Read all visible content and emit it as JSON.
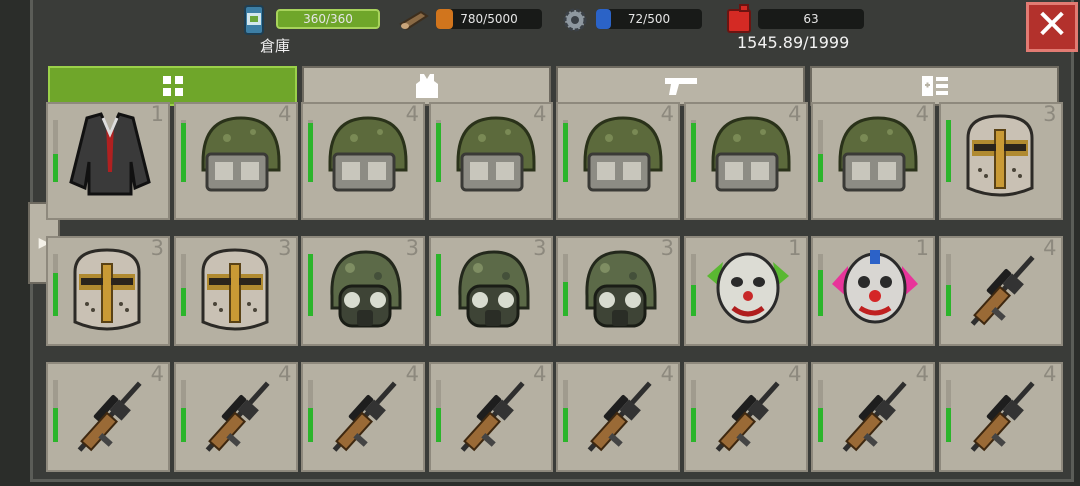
{
  "resources": {
    "food": {
      "icon": "food-can-icon",
      "value": "360/360",
      "fill": 1.0
    },
    "wood": {
      "icon": "wood-log-icon",
      "value": "780/5000",
      "fill": 0.156
    },
    "iron": {
      "icon": "gear-icon",
      "value": "72/500",
      "fill": 0.144
    },
    "fuel": {
      "icon": "fuel-can-icon",
      "value": "63"
    }
  },
  "storage": {
    "label": "倉庫",
    "capacity": "1545.89/1999"
  },
  "tabs": [
    {
      "name": "all-items",
      "icon": "grid-icon",
      "active": true
    },
    {
      "name": "armor",
      "icon": "vest-icon",
      "active": false
    },
    {
      "name": "weapons",
      "icon": "pistol-icon",
      "active": false
    },
    {
      "name": "consumables",
      "icon": "list-icon",
      "active": false
    }
  ],
  "items": [
    {
      "icon": "suit-jacket-icon",
      "count": "1",
      "durability": 0.45
    },
    {
      "icon": "military-helmet-icon",
      "count": "4",
      "durability": 0.95
    },
    {
      "icon": "military-helmet-icon",
      "count": "4",
      "durability": 0.95
    },
    {
      "icon": "military-helmet-icon",
      "count": "4",
      "durability": 0.95
    },
    {
      "icon": "military-helmet-icon",
      "count": "4",
      "durability": 0.95
    },
    {
      "icon": "military-helmet-icon",
      "count": "4",
      "durability": 0.95
    },
    {
      "icon": "military-helmet-icon",
      "count": "4",
      "durability": 0.45
    },
    {
      "icon": "crusader-helmet-icon",
      "count": "3",
      "durability": 1.0
    },
    {
      "icon": "crusader-helmet-icon",
      "count": "3",
      "durability": 0.7
    },
    {
      "icon": "crusader-helmet-icon",
      "count": "3",
      "durability": 0.45
    },
    {
      "icon": "gas-mask-helmet-icon",
      "count": "3",
      "durability": 1.0
    },
    {
      "icon": "gas-mask-helmet-icon",
      "count": "3",
      "durability": 1.0
    },
    {
      "icon": "gas-mask-helmet-icon",
      "count": "3",
      "durability": 0.55
    },
    {
      "icon": "clown-mask-icon",
      "count": "1",
      "durability": 0.5
    },
    {
      "icon": "clown-mask-pink-icon",
      "count": "1",
      "durability": 0.75
    },
    {
      "icon": "sniper-rifle-icon",
      "count": "4",
      "durability": 0.5
    },
    {
      "icon": "sniper-rifle-icon",
      "count": "4",
      "durability": 0.55
    },
    {
      "icon": "sniper-rifle-icon",
      "count": "4",
      "durability": 0.55
    },
    {
      "icon": "sniper-rifle-icon",
      "count": "4",
      "durability": 0.55
    },
    {
      "icon": "sniper-rifle-icon",
      "count": "4",
      "durability": 0.55
    },
    {
      "icon": "sniper-rifle-icon",
      "count": "4",
      "durability": 0.55
    },
    {
      "icon": "sniper-rifle-icon",
      "count": "4",
      "durability": 0.55
    },
    {
      "icon": "sniper-rifle-icon",
      "count": "4",
      "durability": 0.55
    },
    {
      "icon": "sniper-rifle-icon",
      "count": "4",
      "durability": 0.55
    }
  ],
  "colors": {
    "accent_green": "#6fa62a",
    "durability_green": "#2bb52b",
    "close_red": "#b3312c"
  }
}
